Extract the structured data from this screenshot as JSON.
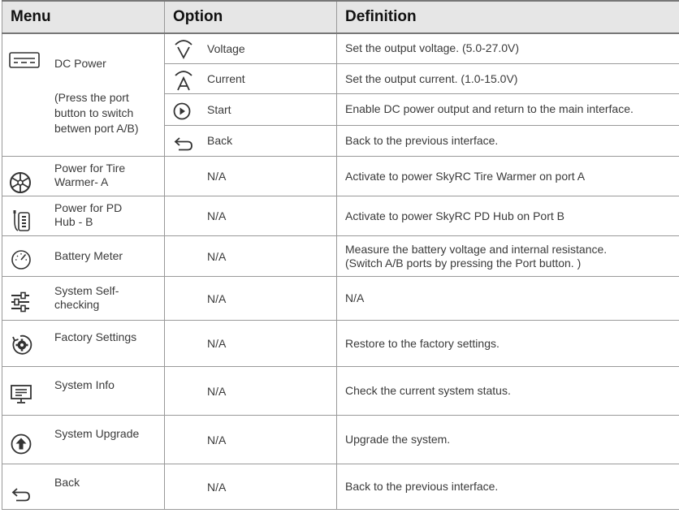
{
  "headers": {
    "menu": "Menu",
    "option": "Option",
    "definition": "Definition"
  },
  "dc_power": {
    "label": "DC Power",
    "note_1": "(Press the port",
    "note_2": "button to switch",
    "note_3": "betwen port A/B)",
    "options": [
      {
        "icon": "voltage-chevron-icon",
        "label": "Voltage",
        "definition": "Set the output voltage. (5.0-27.0V)"
      },
      {
        "icon": "current-chevron-icon",
        "label": "Current",
        "definition": "Set the output current. (1.0-15.0V)"
      },
      {
        "icon": "play-circle-icon",
        "label": "Start",
        "definition": "Enable DC power output and return to the main interface."
      },
      {
        "icon": "back-arrow-icon",
        "label": "Back",
        "definition": "Back to the previous interface."
      }
    ]
  },
  "rows": [
    {
      "icon": "tire-warmer-icon",
      "label_1": "Power for Tire",
      "label_2": "Warmer- A",
      "option": "N/A",
      "definition": "Activate to power SkyRC Tire Warmer on port A"
    },
    {
      "icon": "pd-hub-icon",
      "label_1": "Power for PD",
      "label_2": "Hub - B",
      "option": "N/A",
      "definition": "Activate to power SkyRC PD Hub on Port B"
    },
    {
      "icon": "battery-meter-icon",
      "label_1": "Battery Meter",
      "label_2": "",
      "option": "N/A",
      "definition_1": "Measure the battery voltage and internal resistance.",
      "definition_2": "(Switch A/B ports by pressing the Port button. )"
    },
    {
      "icon": "self-check-sliders-icon",
      "label_1": "System Self-",
      "label_2": "checking",
      "option": "N/A",
      "definition": "N/A"
    },
    {
      "icon": "factory-settings-gear-icon",
      "label_1": "Factory Settings",
      "label_2": "",
      "option": "N/A",
      "definition": "Restore to the factory settings."
    },
    {
      "icon": "system-info-monitor-icon",
      "label_1": "System Info",
      "label_2": "",
      "option": "N/A",
      "definition": "Check the current system status."
    },
    {
      "icon": "upgrade-arrow-icon",
      "label_1": "System Upgrade",
      "label_2": "",
      "option": "N/A",
      "definition": "Upgrade the system."
    },
    {
      "icon": "back-arrow-icon",
      "label_1": "Back",
      "label_2": "",
      "option": "N/A",
      "definition": "Back to the previous interface."
    }
  ]
}
